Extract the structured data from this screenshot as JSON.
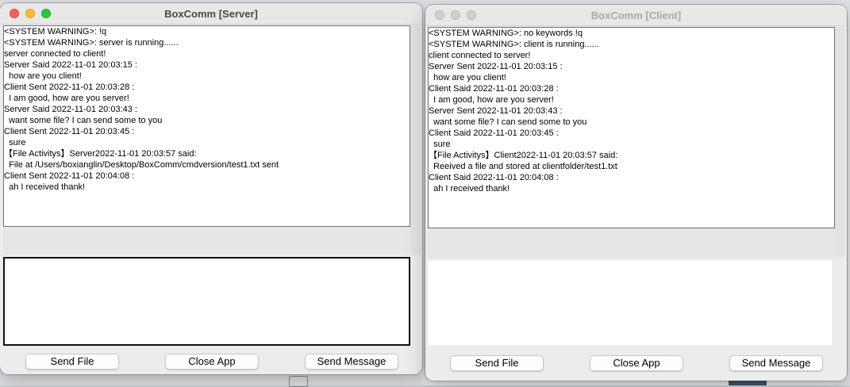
{
  "server": {
    "title": "BoxComm [Server]",
    "log": [
      "<SYSTEM WARNING>: !q",
      "<SYSTEM WARNING>: server is running......",
      "server connected to client!",
      "Server Said 2022-11-01 20:03:15 :",
      "  how are you client!",
      "Client Sent 2022-11-01 20:03:28 :",
      "  I am good, how are you server!",
      "Server Said 2022-11-01 20:03:43 :",
      "  want some file? I can send some to you",
      "Client Sent 2022-11-01 20:03:45 :",
      "  sure",
      "【File Activitys】Server2022-11-01 20:03:57 said:",
      "  File at /Users/boxianglin/Desktop/BoxComm/cmdversion/test1.txt sent",
      "Client Sent 2022-11-01 20:04:08 :",
      "  ah I received thank!"
    ],
    "input_value": "",
    "buttons": {
      "send_file": "Send File",
      "close_app": "Close App",
      "send_message": "Send Message"
    }
  },
  "client": {
    "title": "BoxComm [Client]",
    "log": [
      "<SYSTEM WARNING>: no keywords !q",
      "<SYSTEM WARNING>: client is running......",
      "client connected to server!",
      "Server Sent 2022-11-01 20:03:15 :",
      "  how are you client!",
      "Client Said 2022-11-01 20:03:28 :",
      "  I am good, how are you server!",
      "Server Sent 2022-11-01 20:03:43 :",
      "  want some file? I can send some to you",
      "Client Said 2022-11-01 20:03:45 :",
      "  sure",
      "【File Activitys】Client2022-11-01 20:03:57 said:",
      "  Reeived a file and stored at clientfolder/test1.txt",
      "Client Said 2022-11-01 20:04:08 :",
      "  ah I received thank!"
    ],
    "input_value": "",
    "buttons": {
      "send_file": "Send File",
      "close_app": "Close App",
      "send_message": "Send Message"
    }
  },
  "colors": {
    "close": "#ff5f57",
    "minimize": "#febc2e",
    "zoom": "#28c840",
    "inactive_light": "#cfcfcf"
  }
}
